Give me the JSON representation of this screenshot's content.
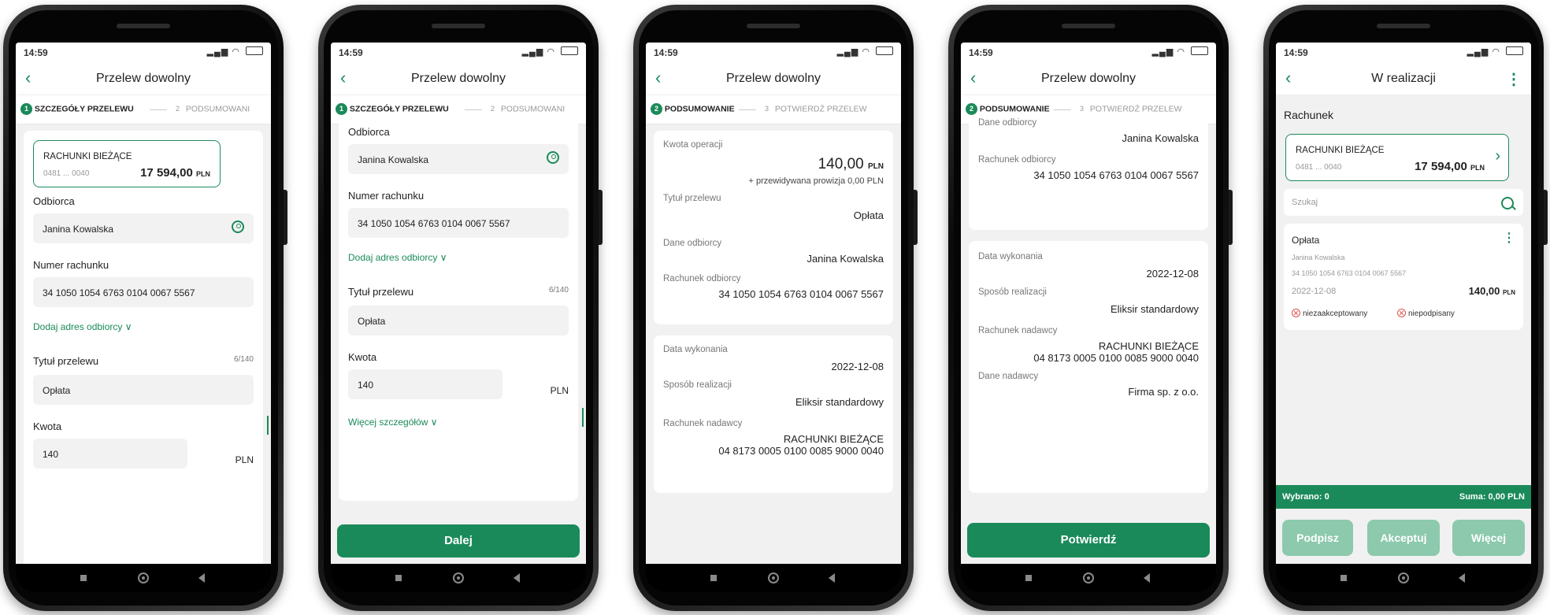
{
  "status": {
    "time": "14:59",
    "icons": "()"
  },
  "colors": {
    "accent": "#1b8a5a",
    "background": "#f1f1f1",
    "error": "#d9534f"
  },
  "screen1": {
    "title": "Przelew dowolny",
    "step1": "SZCZEGÓŁY PRZELEWU",
    "step2": "PODSUMOWANI",
    "account_name": "RACHUNKI BIEŻĄCE",
    "account_no": "0481 ... 0040",
    "balance": "17 594,00",
    "currency": "PLN",
    "recipient_label": "Odbiorca",
    "recipient": "Janina Kowalska",
    "accno_label": "Numer rachunku",
    "accno": "34 1050 1054 6763 0104 0067 5567",
    "add_address": "Dodaj adres odbiorcy ∨",
    "title_label": "Tytuł przelewu",
    "title_count": "6/140",
    "title_value": "Opłata",
    "amount_label": "Kwota",
    "amount": "140",
    "amount_currency": "PLN"
  },
  "screen2": {
    "title": "Przelew dowolny",
    "step1": "SZCZEGÓŁY PRZELEWU",
    "step2": "PODSUMOWANI",
    "recipient_label": "Odbiorca",
    "recipient": "Janina Kowalska",
    "accno_label": "Numer rachunku",
    "accno": "34 1050 1054 6763 0104 0067 5567",
    "add_address": "Dodaj adres odbiorcy ∨",
    "title_label": "Tytuł przelewu",
    "title_count": "6/140",
    "title_value": "Opłata",
    "amount_label": "Kwota",
    "amount": "140",
    "amount_currency": "PLN",
    "more_details": "Więcej szczegółów ∨",
    "next_button": "Dalej"
  },
  "screen3": {
    "title": "Przelew dowolny",
    "step1": "PODSUMOWANIE",
    "step2": "POTWIERDŹ PRZELEW",
    "amount_label": "Kwota operacji",
    "amount": "140,00",
    "currency": "PLN",
    "fee": "+ przewidywana prowizja 0,00 PLN",
    "title_label": "Tytuł przelewu",
    "title_value": "Opłata",
    "recipient_label": "Dane odbiorcy",
    "recipient": "Janina Kowalska",
    "recipient_acc_label": "Rachunek odbiorcy",
    "recipient_acc": "34 1050 1054 6763 0104 0067 5567",
    "date_label": "Data wykonania",
    "date": "2022-12-08",
    "method_label": "Sposób realizacji",
    "method": "Eliksir standardowy",
    "sender_acc_label": "Rachunek nadawcy",
    "sender_acc_name": "RACHUNKI BIEŻĄCE",
    "sender_acc": "04 8173 0005 0100 0085 9000 0040"
  },
  "screen4": {
    "title": "Przelew dowolny",
    "step1": "PODSUMOWANIE",
    "step2": "POTWIERDŹ PRZELEW",
    "recipient_label": "Dane odbiorcy",
    "recipient": "Janina Kowalska",
    "recipient_acc_label": "Rachunek odbiorcy",
    "recipient_acc": "34 1050 1054 6763 0104 0067 5567",
    "date_label": "Data wykonania",
    "date": "2022-12-08",
    "method_label": "Sposób realizacji",
    "method": "Eliksir standardowy",
    "sender_acc_label": "Rachunek nadawcy",
    "sender_acc_name": "RACHUNKI BIEŻĄCE",
    "sender_acc": "04 8173 0005 0100 0085 9000 0040",
    "sender_label": "Dane nadawcy",
    "sender": "Firma sp. z o.o.",
    "confirm_button": "Potwierdź"
  },
  "screen5": {
    "title": "W realizacji",
    "section": "Rachunek",
    "account_name": "RACHUNKI BIEŻĄCE",
    "account_no": "0481 ... 0040",
    "balance": "17 594,00",
    "currency": "PLN",
    "search_placeholder": "Szukaj",
    "item_title": "Opłata",
    "item_recipient": "Janina Kowalska",
    "item_acc": "34 1050 1054 6763 0104 0067 5567",
    "item_date": "2022-12-08",
    "item_amount": "140,00",
    "item_currency": "PLN",
    "status1": "niezaakceptowany",
    "status2": "niepodpisany",
    "selected": "Wybrano: 0",
    "sum": "Suma: 0,00 PLN",
    "sign_button": "Podpisz",
    "accept_button": "Akceptuj",
    "more_button": "Więcej"
  }
}
